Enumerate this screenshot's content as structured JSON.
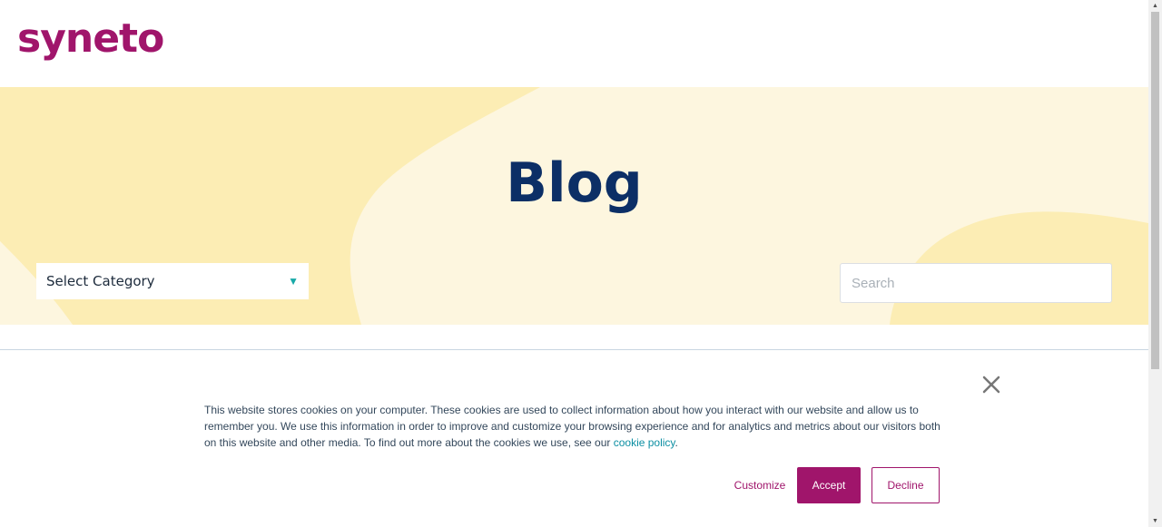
{
  "header": {
    "logo_text": "syneto"
  },
  "hero": {
    "title": "Blog",
    "category_select": {
      "selected": "Select Category",
      "arrow": "▼"
    },
    "search": {
      "placeholder": "Search",
      "value": ""
    }
  },
  "cookie_banner": {
    "text_before_link": "This website stores cookies on your computer. These cookies are used to collect information about how you interact with our website and allow us to remember you. We use this information in order to improve and customize your browsing experience and for analytics and metrics about our visitors both on this website and other media. To find out more about the cookies we use, see our ",
    "link_text": "cookie policy",
    "text_after_link": ".",
    "close_icon": "close-icon",
    "buttons": {
      "customize": "Customize",
      "accept": "Accept",
      "decline": "Decline"
    }
  },
  "colors": {
    "brand": "#a0156b",
    "title": "#0c2f66",
    "hero_bg": "#fdf6df",
    "blob": "#fcedb4",
    "link": "#0d8fa3"
  }
}
